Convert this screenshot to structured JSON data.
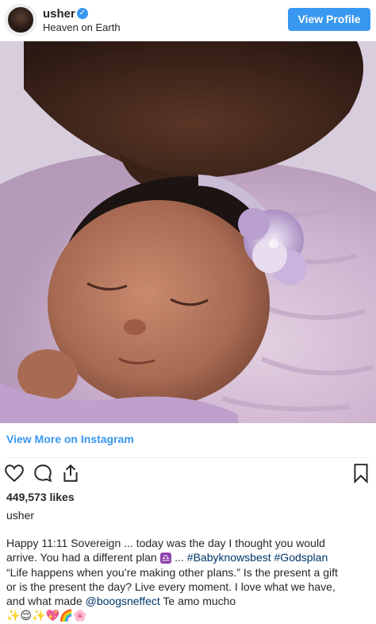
{
  "header": {
    "username": "usher",
    "verified_icon": "✓",
    "location": "Heaven on Earth",
    "view_profile_label": "View Profile"
  },
  "post": {
    "image_description": "newborn baby with lavender flower headband kissed by father",
    "view_more_label": "View More on Instagram",
    "likes": "449,573 likes",
    "owner": "usher",
    "caption": {
      "line1": "Happy 11:11 Sovereign ... today was the day I thought you would",
      "line2_a": "arrive. You had a different plan ",
      "line2_emoji": "♎",
      "line2_b": " ... ",
      "hashtag1": "#Babyknowsbest",
      "hashtag2": "#Godsplan",
      "line3": "“Life happens when you’re making other plans.” Is the present a gift",
      "line4": "or is the present the day? Live every moment. I love what we have,",
      "line5_a": "and what made ",
      "mention": "@boogsneffect",
      "line5_b": " Te amo mucho",
      "line6": "✨😌✨💖🌈🌸"
    }
  },
  "icons": {
    "like": "heart-icon",
    "comment": "comment-icon",
    "share": "share-icon",
    "save": "bookmark-icon"
  },
  "colors": {
    "accent": "#3897f0",
    "text": "#262626",
    "hashtag": "#003569"
  }
}
